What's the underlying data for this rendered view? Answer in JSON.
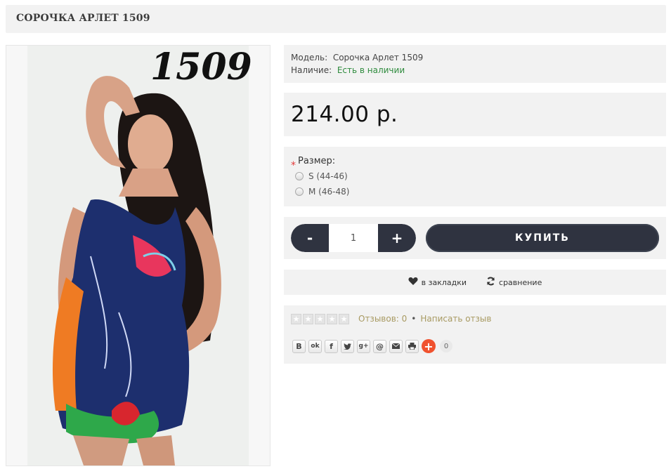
{
  "product": {
    "title": "СОРОЧКА АРЛЕТ 1509",
    "image_label": "1509",
    "model_label": "Модель:",
    "model_value": "Сорочка Арлет 1509",
    "stock_label": "Наличие:",
    "stock_value": "Есть в наличии",
    "price": "214.00 р."
  },
  "options": {
    "required_mark": "*",
    "label": "Размер:",
    "sizes": [
      "S (44-46)",
      "M (46-48)"
    ]
  },
  "cart": {
    "minus_label": "-",
    "plus_label": "+",
    "quantity": "1",
    "buy_label": "КУПИТЬ"
  },
  "actions": {
    "wishlist_label": "в закладки",
    "compare_label": "сравнение"
  },
  "reviews": {
    "rating": 0,
    "max_rating": 5,
    "count_label": "Отзывов: 0",
    "separator": "•",
    "write_label": "Написать отзыв"
  },
  "share": {
    "buttons": [
      "В",
      "ok",
      "f",
      "twitter",
      "g+",
      "@",
      "mail",
      "print"
    ],
    "count": "0"
  },
  "colors": {
    "panel_bg": "#f2f2f2",
    "dark_button": "#2f3340",
    "in_stock": "#2e8b3d",
    "review_link": "#a89a62",
    "share_plus": "#f0522f"
  }
}
